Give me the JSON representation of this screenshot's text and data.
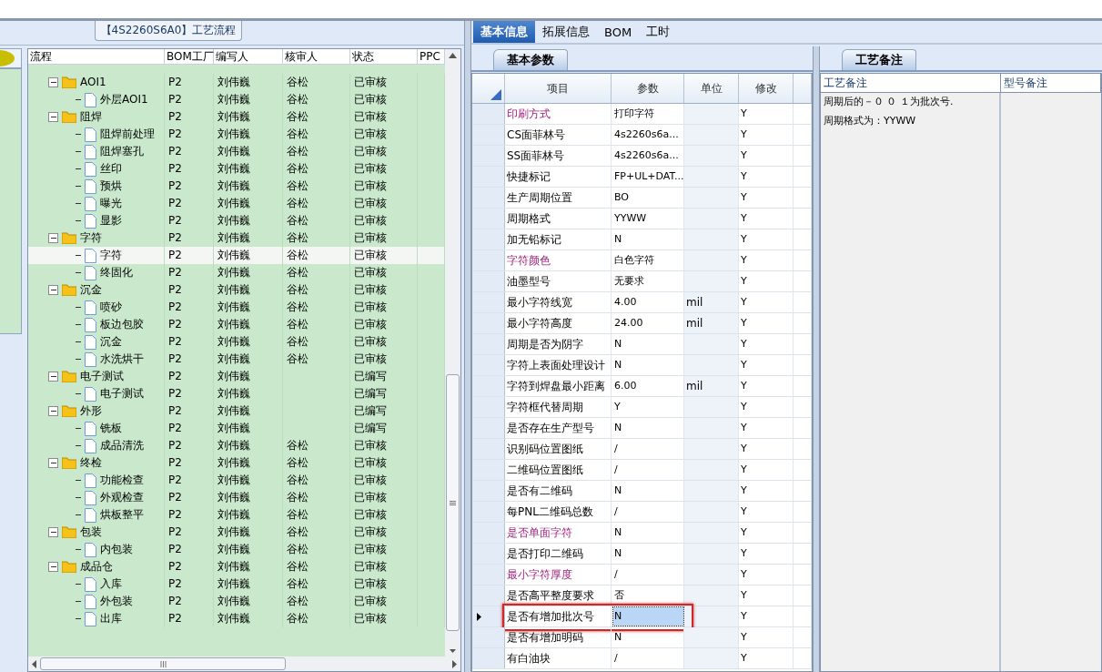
{
  "left_panel": {
    "title": "【4S2260S6A0】工艺流程",
    "columns": [
      "流程",
      "BOM工厂",
      "编写人",
      "核审人",
      "状态",
      "PPC"
    ],
    "rows": [
      {
        "label": "AOI1",
        "bom": "P2",
        "writer": "刘伟巍",
        "reviewer": "谷松",
        "status": "已审核",
        "expanded": true,
        "selected": false,
        "children": [
          {
            "label": "外层AOI1",
            "bom": "P2",
            "writer": "刘伟巍",
            "reviewer": "谷松",
            "status": "已审核",
            "selected": false
          }
        ]
      },
      {
        "label": "阻焊",
        "bom": "P2",
        "writer": "刘伟巍",
        "reviewer": "谷松",
        "status": "已审核",
        "expanded": true,
        "selected": false,
        "children": [
          {
            "label": "阻焊前处理",
            "bom": "P2",
            "writer": "刘伟巍",
            "reviewer": "谷松",
            "status": "已审核",
            "selected": false
          },
          {
            "label": "阻焊塞孔",
            "bom": "P2",
            "writer": "刘伟巍",
            "reviewer": "谷松",
            "status": "已审核",
            "selected": false
          },
          {
            "label": "丝印",
            "bom": "P2",
            "writer": "刘伟巍",
            "reviewer": "谷松",
            "status": "已审核",
            "selected": false
          },
          {
            "label": "预烘",
            "bom": "P2",
            "writer": "刘伟巍",
            "reviewer": "谷松",
            "status": "已审核",
            "selected": false
          },
          {
            "label": "曝光",
            "bom": "P2",
            "writer": "刘伟巍",
            "reviewer": "谷松",
            "status": "已审核",
            "selected": false
          },
          {
            "label": "显影",
            "bom": "P2",
            "writer": "刘伟巍",
            "reviewer": "谷松",
            "status": "已审核",
            "selected": false
          }
        ]
      },
      {
        "label": "字符",
        "bom": "P2",
        "writer": "刘伟巍",
        "reviewer": "谷松",
        "status": "已审核",
        "expanded": true,
        "selected": false,
        "children": [
          {
            "label": "字符",
            "bom": "P2",
            "writer": "刘伟巍",
            "reviewer": "谷松",
            "status": "已审核",
            "selected": true
          },
          {
            "label": "终固化",
            "bom": "P2",
            "writer": "刘伟巍",
            "reviewer": "谷松",
            "status": "已审核",
            "selected": false
          }
        ]
      },
      {
        "label": "沉金",
        "bom": "P2",
        "writer": "刘伟巍",
        "reviewer": "谷松",
        "status": "已审核",
        "expanded": true,
        "selected": false,
        "children": [
          {
            "label": "喷砂",
            "bom": "P2",
            "writer": "刘伟巍",
            "reviewer": "谷松",
            "status": "已审核",
            "selected": false
          },
          {
            "label": "板边包胶",
            "bom": "P2",
            "writer": "刘伟巍",
            "reviewer": "谷松",
            "status": "已审核",
            "selected": false
          },
          {
            "label": "沉金",
            "bom": "P2",
            "writer": "刘伟巍",
            "reviewer": "谷松",
            "status": "已审核",
            "selected": false
          },
          {
            "label": "水洗烘干",
            "bom": "P2",
            "writer": "刘伟巍",
            "reviewer": "谷松",
            "status": "已审核",
            "selected": false
          }
        ]
      },
      {
        "label": "电子测试",
        "bom": "P2",
        "writer": "刘伟巍",
        "status": "已编写",
        "expanded": true,
        "selected": false,
        "children": [
          {
            "label": "电子测试",
            "bom": "P2",
            "writer": "刘伟巍",
            "status": "已编写",
            "selected": false
          }
        ]
      },
      {
        "label": "外形",
        "bom": "P2",
        "writer": "刘伟巍",
        "status": "已编写",
        "expanded": true,
        "selected": false,
        "children": [
          {
            "label": "铣板",
            "bom": "P2",
            "writer": "刘伟巍",
            "status": "已编写",
            "selected": false
          },
          {
            "label": "成品清洗",
            "bom": "P2",
            "writer": "刘伟巍",
            "reviewer": "谷松",
            "status": "已审核",
            "selected": false
          }
        ]
      },
      {
        "label": "终检",
        "bom": "P2",
        "writer": "刘伟巍",
        "reviewer": "谷松",
        "status": "已审核",
        "expanded": true,
        "selected": false,
        "children": [
          {
            "label": "功能检查",
            "bom": "P2",
            "writer": "刘伟巍",
            "reviewer": "谷松",
            "status": "已审核",
            "selected": false
          },
          {
            "label": "外观检查",
            "bom": "P2",
            "writer": "刘伟巍",
            "reviewer": "谷松",
            "status": "已审核",
            "selected": false
          },
          {
            "label": "烘板整平",
            "bom": "P2",
            "writer": "刘伟巍",
            "reviewer": "谷松",
            "status": "已审核",
            "selected": false
          }
        ]
      },
      {
        "label": "包装",
        "bom": "P2",
        "writer": "刘伟巍",
        "reviewer": "谷松",
        "status": "已审核",
        "expanded": true,
        "selected": false,
        "children": [
          {
            "label": "内包装",
            "bom": "P2",
            "writer": "刘伟巍",
            "reviewer": "谷松",
            "status": "已审核",
            "selected": false
          }
        ]
      },
      {
        "label": "成品仓",
        "bom": "P2",
        "writer": "刘伟巍",
        "reviewer": "谷松",
        "status": "已审核",
        "expanded": true,
        "selected": false,
        "children": [
          {
            "label": "入库",
            "bom": "P2",
            "writer": "刘伟巍",
            "reviewer": "谷松",
            "status": "已审核",
            "selected": false
          },
          {
            "label": "外包装",
            "bom": "P2",
            "writer": "刘伟巍",
            "reviewer": "谷松",
            "status": "已审核",
            "selected": false
          },
          {
            "label": "出库",
            "bom": "P2",
            "writer": "刘伟巍",
            "reviewer": "谷松",
            "status": "已审核",
            "selected": false
          }
        ]
      }
    ]
  },
  "tabs": [
    {
      "label": "基本信息",
      "selected": true
    },
    {
      "label": "拓展信息",
      "selected": false
    },
    {
      "label": "BOM",
      "selected": false
    },
    {
      "label": "工时",
      "selected": false
    }
  ],
  "params": {
    "tab": "基本参数",
    "columns": [
      "项目",
      "参数",
      "单位",
      "修改"
    ],
    "rows": [
      {
        "item": "印刷方式",
        "value": "打印字符",
        "modify": "Y",
        "required": true,
        "selected": false
      },
      {
        "item": "CS面菲林号",
        "value": "4s2260s6a...",
        "modify": "Y",
        "required": false,
        "selected": false
      },
      {
        "item": "SS面菲林号",
        "value": "4s2260s6a...",
        "modify": "Y",
        "required": false,
        "selected": false
      },
      {
        "item": "快捷标记",
        "value": "FP+UL+DAT...",
        "modify": "Y",
        "required": false,
        "selected": false
      },
      {
        "item": "生产周期位置",
        "value": "BO",
        "modify": "Y",
        "required": false,
        "selected": false
      },
      {
        "item": "周期格式",
        "value": "YYWW",
        "modify": "Y",
        "required": false,
        "selected": false
      },
      {
        "item": "加无铅标记",
        "value": "N",
        "modify": "Y",
        "required": false,
        "selected": false
      },
      {
        "item": "字符颜色",
        "value": "白色字符",
        "modify": "Y",
        "required": true,
        "selected": false
      },
      {
        "item": "油墨型号",
        "value": "无要求",
        "modify": "Y",
        "required": false,
        "selected": false
      },
      {
        "item": "最小字符线宽",
        "value": "4.00",
        "unit": "mil",
        "modify": "Y",
        "required": false,
        "selected": false
      },
      {
        "item": "最小字符高度",
        "value": "24.00",
        "unit": "mil",
        "modify": "Y",
        "required": false,
        "selected": false
      },
      {
        "item": "周期是否为阴字",
        "value": "N",
        "modify": "Y",
        "required": false,
        "selected": false
      },
      {
        "item": "字符上表面处理设计",
        "value": "N",
        "modify": "Y",
        "required": false,
        "selected": false
      },
      {
        "item": "字符到焊盘最小距离",
        "value": "6.00",
        "unit": "mil",
        "modify": "Y",
        "required": false,
        "selected": false
      },
      {
        "item": "字符框代替周期",
        "value": "Y",
        "modify": "Y",
        "required": false,
        "selected": false
      },
      {
        "item": "是否存在生产型号",
        "value": "N",
        "modify": "Y",
        "required": false,
        "selected": false
      },
      {
        "item": "识别码位置图纸",
        "value": "/",
        "modify": "Y",
        "required": false,
        "selected": false
      },
      {
        "item": "二维码位置图纸",
        "value": "/",
        "modify": "Y",
        "required": false,
        "selected": false
      },
      {
        "item": "是否有二维码",
        "value": "N",
        "modify": "Y",
        "required": false,
        "selected": false
      },
      {
        "item": "每PNL二维码总数",
        "value": "/",
        "modify": "Y",
        "required": false,
        "selected": false
      },
      {
        "item": "是否单面字符",
        "value": "N",
        "modify": "Y",
        "required": true,
        "selected": false
      },
      {
        "item": "是否打印二维码",
        "value": "N",
        "modify": "Y",
        "required": false,
        "selected": false
      },
      {
        "item": "最小字符厚度",
        "value": "/",
        "modify": "Y",
        "required": true,
        "selected": false
      },
      {
        "item": "是否高平整度要求",
        "value": "否",
        "modify": "Y",
        "required": false,
        "selected": false
      },
      {
        "item": "是否有增加批次号",
        "value": "N",
        "modify": "Y",
        "required": false,
        "selected": true
      },
      {
        "item": "是否有增加明码",
        "value": "N",
        "modify": "Y",
        "required": false,
        "selected": false
      },
      {
        "item": "有白油块",
        "value": "/",
        "modify": "Y",
        "required": false,
        "selected": false
      }
    ]
  },
  "notes": {
    "tab": "工艺备注",
    "columns": [
      "工艺备注",
      "型号备注"
    ],
    "lines": [
      "周期后的－０ ０ １为批次号.",
      "周期格式为：YYWW"
    ]
  }
}
